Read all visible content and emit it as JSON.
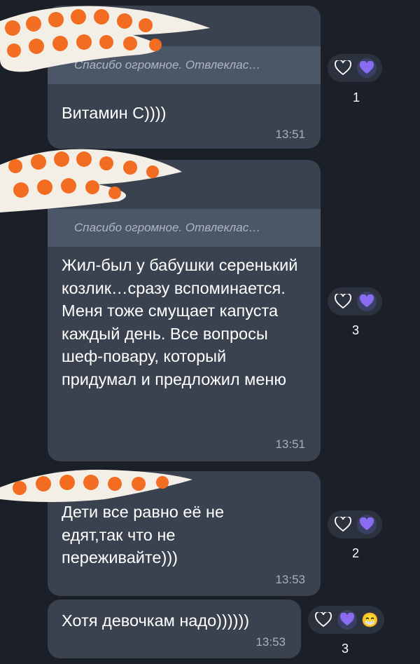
{
  "messages": [
    {
      "quote": "Спасибо огромное. Отвлеклас…",
      "text": "Витамин С))))",
      "time": "13:51",
      "reaction_count": "1"
    },
    {
      "quote": "Спасибо огромное. Отвлеклас…",
      "text": "Жил-был у бабушки серенький козлик…сразу вспоминается. Меня тоже смущает капуста каждый день. Все вопросы шеф-повару, который придумал и предложил меню",
      "time": "13:51",
      "reaction_count": "3"
    },
    {
      "text": "Дети все равно её не едят,так что не переживайте)))",
      "time": "13:53",
      "reaction_count": "2"
    },
    {
      "text": "Хотя девочкам надо))))))",
      "time": "13:53",
      "reaction_count": "3",
      "extra_reaction": "😁"
    }
  ],
  "colors": {
    "background": "#1b2028",
    "bubble": "#3a424f",
    "quote": "#4b5666",
    "heart_fill": "#8a6cf0",
    "blob_orange": "#f26d21"
  },
  "icons": [
    "heart-outline-icon",
    "purple-heart-icon",
    "grinning-emoji-icon"
  ]
}
